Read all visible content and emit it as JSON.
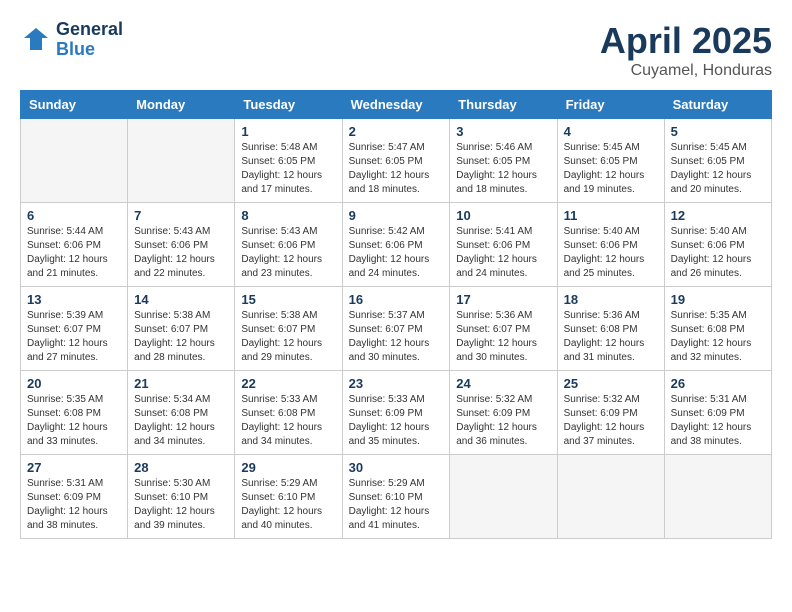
{
  "logo": {
    "general": "General",
    "blue": "Blue"
  },
  "header": {
    "month": "April 2025",
    "location": "Cuyamel, Honduras"
  },
  "weekdays": [
    "Sunday",
    "Monday",
    "Tuesday",
    "Wednesday",
    "Thursday",
    "Friday",
    "Saturday"
  ],
  "weeks": [
    [
      {
        "day": "",
        "info": ""
      },
      {
        "day": "",
        "info": ""
      },
      {
        "day": "1",
        "info": "Sunrise: 5:48 AM\nSunset: 6:05 PM\nDaylight: 12 hours\nand 17 minutes."
      },
      {
        "day": "2",
        "info": "Sunrise: 5:47 AM\nSunset: 6:05 PM\nDaylight: 12 hours\nand 18 minutes."
      },
      {
        "day": "3",
        "info": "Sunrise: 5:46 AM\nSunset: 6:05 PM\nDaylight: 12 hours\nand 18 minutes."
      },
      {
        "day": "4",
        "info": "Sunrise: 5:45 AM\nSunset: 6:05 PM\nDaylight: 12 hours\nand 19 minutes."
      },
      {
        "day": "5",
        "info": "Sunrise: 5:45 AM\nSunset: 6:05 PM\nDaylight: 12 hours\nand 20 minutes."
      }
    ],
    [
      {
        "day": "6",
        "info": "Sunrise: 5:44 AM\nSunset: 6:06 PM\nDaylight: 12 hours\nand 21 minutes."
      },
      {
        "day": "7",
        "info": "Sunrise: 5:43 AM\nSunset: 6:06 PM\nDaylight: 12 hours\nand 22 minutes."
      },
      {
        "day": "8",
        "info": "Sunrise: 5:43 AM\nSunset: 6:06 PM\nDaylight: 12 hours\nand 23 minutes."
      },
      {
        "day": "9",
        "info": "Sunrise: 5:42 AM\nSunset: 6:06 PM\nDaylight: 12 hours\nand 24 minutes."
      },
      {
        "day": "10",
        "info": "Sunrise: 5:41 AM\nSunset: 6:06 PM\nDaylight: 12 hours\nand 24 minutes."
      },
      {
        "day": "11",
        "info": "Sunrise: 5:40 AM\nSunset: 6:06 PM\nDaylight: 12 hours\nand 25 minutes."
      },
      {
        "day": "12",
        "info": "Sunrise: 5:40 AM\nSunset: 6:06 PM\nDaylight: 12 hours\nand 26 minutes."
      }
    ],
    [
      {
        "day": "13",
        "info": "Sunrise: 5:39 AM\nSunset: 6:07 PM\nDaylight: 12 hours\nand 27 minutes."
      },
      {
        "day": "14",
        "info": "Sunrise: 5:38 AM\nSunset: 6:07 PM\nDaylight: 12 hours\nand 28 minutes."
      },
      {
        "day": "15",
        "info": "Sunrise: 5:38 AM\nSunset: 6:07 PM\nDaylight: 12 hours\nand 29 minutes."
      },
      {
        "day": "16",
        "info": "Sunrise: 5:37 AM\nSunset: 6:07 PM\nDaylight: 12 hours\nand 30 minutes."
      },
      {
        "day": "17",
        "info": "Sunrise: 5:36 AM\nSunset: 6:07 PM\nDaylight: 12 hours\nand 30 minutes."
      },
      {
        "day": "18",
        "info": "Sunrise: 5:36 AM\nSunset: 6:08 PM\nDaylight: 12 hours\nand 31 minutes."
      },
      {
        "day": "19",
        "info": "Sunrise: 5:35 AM\nSunset: 6:08 PM\nDaylight: 12 hours\nand 32 minutes."
      }
    ],
    [
      {
        "day": "20",
        "info": "Sunrise: 5:35 AM\nSunset: 6:08 PM\nDaylight: 12 hours\nand 33 minutes."
      },
      {
        "day": "21",
        "info": "Sunrise: 5:34 AM\nSunset: 6:08 PM\nDaylight: 12 hours\nand 34 minutes."
      },
      {
        "day": "22",
        "info": "Sunrise: 5:33 AM\nSunset: 6:08 PM\nDaylight: 12 hours\nand 34 minutes."
      },
      {
        "day": "23",
        "info": "Sunrise: 5:33 AM\nSunset: 6:09 PM\nDaylight: 12 hours\nand 35 minutes."
      },
      {
        "day": "24",
        "info": "Sunrise: 5:32 AM\nSunset: 6:09 PM\nDaylight: 12 hours\nand 36 minutes."
      },
      {
        "day": "25",
        "info": "Sunrise: 5:32 AM\nSunset: 6:09 PM\nDaylight: 12 hours\nand 37 minutes."
      },
      {
        "day": "26",
        "info": "Sunrise: 5:31 AM\nSunset: 6:09 PM\nDaylight: 12 hours\nand 38 minutes."
      }
    ],
    [
      {
        "day": "27",
        "info": "Sunrise: 5:31 AM\nSunset: 6:09 PM\nDaylight: 12 hours\nand 38 minutes."
      },
      {
        "day": "28",
        "info": "Sunrise: 5:30 AM\nSunset: 6:10 PM\nDaylight: 12 hours\nand 39 minutes."
      },
      {
        "day": "29",
        "info": "Sunrise: 5:29 AM\nSunset: 6:10 PM\nDaylight: 12 hours\nand 40 minutes."
      },
      {
        "day": "30",
        "info": "Sunrise: 5:29 AM\nSunset: 6:10 PM\nDaylight: 12 hours\nand 41 minutes."
      },
      {
        "day": "",
        "info": ""
      },
      {
        "day": "",
        "info": ""
      },
      {
        "day": "",
        "info": ""
      }
    ]
  ]
}
